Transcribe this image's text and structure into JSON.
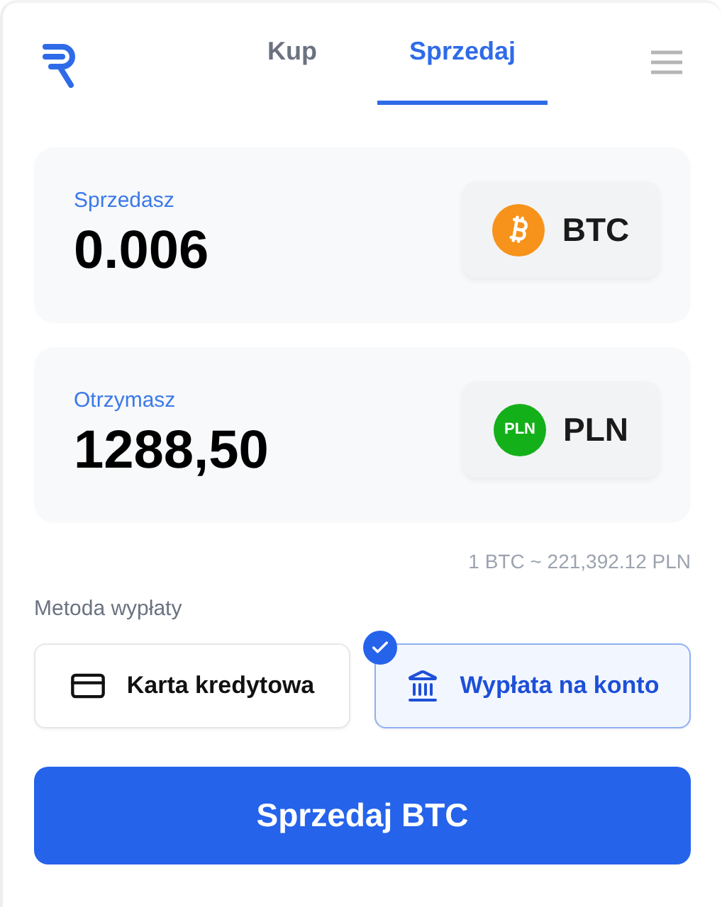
{
  "tabs": [
    {
      "label": "Kup",
      "selected": false
    },
    {
      "label": "Sprzedaj",
      "selected": true
    }
  ],
  "amounts": [
    {
      "label": "Sprzedasz",
      "value": "0.006",
      "currency": {
        "code": "BTC",
        "kind": "btc",
        "color": "#f7931a"
      }
    },
    {
      "label": "Otrzymasz",
      "value": "1288,50",
      "currency": {
        "code": "PLN",
        "kind": "pln",
        "badge": "PLN",
        "color": "#14b01a"
      }
    }
  ],
  "rate": "1 BTC ~ 221,392.12 PLN",
  "payout": {
    "label": "Metoda wypłaty",
    "methods": [
      {
        "label": "Karta kredytowa",
        "kind": "card",
        "selected": false
      },
      {
        "label": "Wypłata na konto",
        "kind": "bank",
        "selected": true
      }
    ]
  },
  "submit": "Sprzedaj BTC"
}
